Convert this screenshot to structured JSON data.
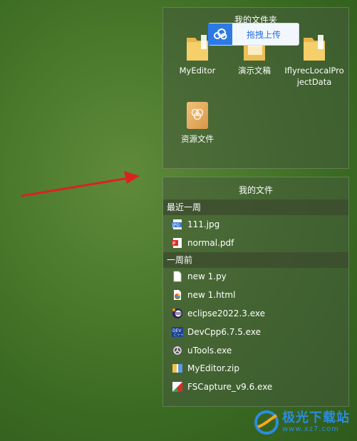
{
  "folders_panel": {
    "title": "我的文件夹",
    "folders": [
      {
        "label": "MyEditor",
        "icon": "folder-icon"
      },
      {
        "label": "演示文稿",
        "icon": "folder-icon"
      },
      {
        "label": "IflyrecLocalProjectData",
        "icon": "folder-icon"
      },
      {
        "label": "资源文件",
        "icon": "resource-folder-icon"
      }
    ],
    "upload_button": "拖拽上传"
  },
  "files_panel": {
    "title": "我的文件",
    "sections": [
      {
        "header": "最近一周",
        "files": [
          {
            "name": "111.jpg",
            "icon": "jpg-file-icon"
          },
          {
            "name": "normal.pdf",
            "icon": "pdf-file-icon"
          }
        ]
      },
      {
        "header": "一周前",
        "files": [
          {
            "name": "new 1.py",
            "icon": "blank-file-icon"
          },
          {
            "name": "new 1.html",
            "icon": "html-file-icon"
          },
          {
            "name": "eclipse2022.3.exe",
            "icon": "eclipse-icon"
          },
          {
            "name": "DevCpp6.7.5.exe",
            "icon": "devcpp-icon"
          },
          {
            "name": "uTools.exe",
            "icon": "utools-icon"
          },
          {
            "name": "MyEditor.zip",
            "icon": "zip-file-icon"
          },
          {
            "name": "FSCapture_v9.6.exe",
            "icon": "fscapture-icon"
          }
        ]
      }
    ]
  },
  "watermark": {
    "title": "极光下载站",
    "url": "www.xz7.com"
  },
  "colors": {
    "accent_blue": "#2d7ae5",
    "arrow_red": "#d9231f"
  }
}
